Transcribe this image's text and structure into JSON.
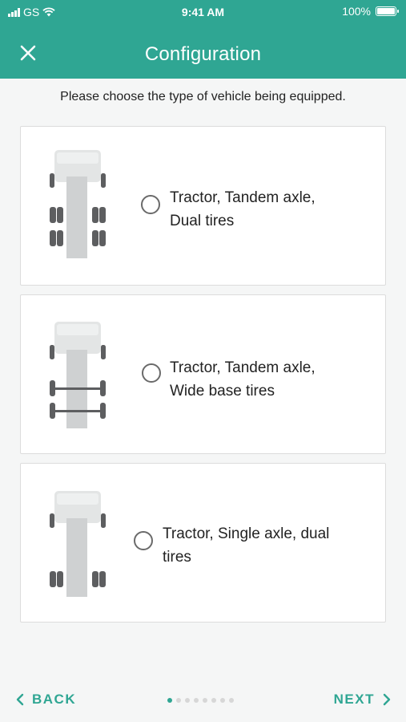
{
  "status_bar": {
    "carrier": "GS",
    "time": "9:41 AM",
    "battery": "100%",
    "battery_level": 1.0
  },
  "header": {
    "title": "Configuration",
    "close_icon": "close-icon"
  },
  "instructions": "Please choose the type of vehicle being equipped.",
  "options": [
    {
      "label_line1": "Tractor, Tandem axle,",
      "label_line2": "Dual tires",
      "selected": false,
      "icon": "tractor-tandem-dual-icon"
    },
    {
      "label_line1": "Tractor, Tandem axle,",
      "label_line2": "Wide base tires",
      "selected": false,
      "icon": "tractor-tandem-wide-icon"
    },
    {
      "label_line1": "Tractor, Single axle, dual",
      "label_line2": "tires",
      "selected": false,
      "icon": "tractor-single-dual-icon"
    }
  ],
  "footer": {
    "back_label": "BACK",
    "next_label": "NEXT",
    "page_count": 8,
    "current_page": 1
  },
  "colors": {
    "accent": "#2fa693",
    "background": "#f5f6f6"
  }
}
